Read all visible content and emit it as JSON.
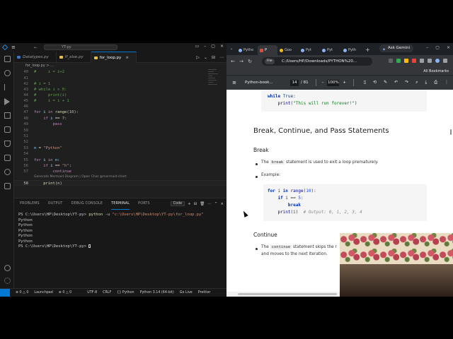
{
  "vscode": {
    "search_text": "YT-py",
    "tabs": [
      {
        "label": "Datatypes.py",
        "active": false
      },
      {
        "label": "If_else.py",
        "active": false
      },
      {
        "label": "for_loop.py",
        "active": true
      }
    ],
    "tab_close": "×",
    "editor_actions": [
      "▷",
      "⌄",
      "⊟",
      "⋯"
    ],
    "breadcrumb": "for_loop.py > ...",
    "lines": [
      {
        "n": "40",
        "tokens": [
          [
            "cm",
            "#     i = i+2"
          ]
        ]
      },
      {
        "n": "41",
        "tokens": []
      },
      {
        "n": "42",
        "tokens": [
          [
            "cm",
            "# i = 1"
          ]
        ]
      },
      {
        "n": "43",
        "tokens": [
          [
            "cm",
            "# while i > 0:"
          ]
        ]
      },
      {
        "n": "44",
        "tokens": [
          [
            "cm",
            "#     print(i)"
          ]
        ]
      },
      {
        "n": "45",
        "tokens": [
          [
            "cm",
            "#     i = i + 1"
          ]
        ]
      },
      {
        "n": "46",
        "tokens": []
      },
      {
        "n": "47",
        "tokens": [
          [
            "kw",
            "for "
          ],
          [
            "var",
            "i "
          ],
          [
            "kw",
            "in "
          ],
          [
            "fn",
            "range"
          ],
          [
            "op",
            "("
          ],
          [
            "num",
            "10"
          ],
          [
            "op",
            "):"
          ]
        ]
      },
      {
        "n": "48",
        "tokens": [
          [
            "op",
            "    "
          ],
          [
            "kw",
            "if "
          ],
          [
            "var",
            "i "
          ],
          [
            "op",
            "== "
          ],
          [
            "num",
            "7"
          ],
          [
            "op",
            ":"
          ]
        ]
      },
      {
        "n": "49",
        "tokens": [
          [
            "op",
            "        "
          ],
          [
            "kw",
            "pass"
          ]
        ]
      },
      {
        "n": "50",
        "tokens": []
      },
      {
        "n": "51",
        "tokens": []
      },
      {
        "n": "52",
        "tokens": []
      },
      {
        "n": "53",
        "tokens": [
          [
            "var",
            "n "
          ],
          [
            "op",
            "= "
          ],
          [
            "str",
            "\"Python\""
          ]
        ]
      },
      {
        "n": "54",
        "tokens": []
      },
      {
        "n": "55",
        "tokens": [
          [
            "kw",
            "for "
          ],
          [
            "var",
            "i "
          ],
          [
            "kw",
            "in "
          ],
          [
            "var",
            "n"
          ],
          [
            "op",
            ":"
          ]
        ]
      },
      {
        "n": "56",
        "tokens": [
          [
            "op",
            "    "
          ],
          [
            "kw",
            "if "
          ],
          [
            "var",
            "i "
          ],
          [
            "op",
            "== "
          ],
          [
            "str",
            "\"h\""
          ],
          [
            "op",
            ":"
          ]
        ]
      },
      {
        "n": "57",
        "tokens": [
          [
            "op",
            "        "
          ],
          [
            "kw",
            "continue"
          ]
        ]
      },
      {
        "n": "",
        "codelens": "Generate Mermaid Diagram | Open Chat @mermaid-chart"
      },
      {
        "n": "58",
        "current": true,
        "tokens": [
          [
            "op",
            "    "
          ],
          [
            "fn",
            "print"
          ],
          [
            "op",
            "("
          ],
          [
            "var",
            "n"
          ],
          [
            "op",
            ")"
          ]
        ]
      }
    ],
    "panel_tabs": [
      "PROBLEMS",
      "OUTPUT",
      "DEBUG CONSOLE",
      "TERMINAL",
      "PORTS"
    ],
    "panel_active": "TERMINAL",
    "panel_select": "Code",
    "panel_icons": [
      "+",
      "⊟",
      "🗑",
      "⋯",
      "⌃",
      "×"
    ],
    "terminal": {
      "prompt": "PS C:\\Users\\HP\\Desktop\\YT-py>",
      "command": "python",
      "flag": "-u",
      "arg": "\"c:\\Users\\HP\\Desktop\\YT-py\\for_loop.py\"",
      "output": [
        "Python",
        "Python",
        "Python",
        "Python",
        "Python"
      ],
      "last_prompt": "PS C:\\Users\\HP\\Desktop\\YT-py>"
    },
    "status": [
      "⊗ 0  △ 0",
      "Launchpad",
      "⊗ 0  △ 0",
      "UTF-8",
      "CRLF",
      "{} Python",
      "Python 3.14 (64-bit)",
      "Go Live",
      "Prettier"
    ]
  },
  "chrome": {
    "tabs": [
      {
        "label": "Pytho",
        "icon": "globe"
      },
      {
        "label": "P",
        "icon": "pdf",
        "active": true
      },
      {
        "label": "Goo",
        "icon": "g"
      },
      {
        "label": "Pyt",
        "icon": "globe"
      },
      {
        "label": "Pyt",
        "icon": "globe"
      },
      {
        "label": "Pyth",
        "icon": "globe"
      }
    ],
    "ask_gemini": "Ask Gemini",
    "file_chip": "File",
    "url": "C:/Users/HP/Downloads/PYTHON%20...",
    "all_bookmarks": "All Bookmarks",
    "pdf": {
      "title": "Python-book...",
      "page": "14",
      "total": "/ 81",
      "zoom": "100%",
      "code1": {
        "lines": [
          [
            [
              "kw",
              "while "
            ],
            [
              "const",
              "True"
            ],
            [
              "op",
              ":"
            ]
          ],
          [
            [
              "op",
              "    "
            ],
            [
              "fn",
              "print"
            ],
            [
              "op",
              "("
            ],
            [
              "str",
              "\"This will run forever!\""
            ],
            [
              "op",
              ")"
            ]
          ]
        ]
      },
      "heading": "Break, Continue, and Pass Statements",
      "break_heading": "Break",
      "break_text_pre": "The",
      "break_code": "break",
      "break_text_post": "statement is used to exit a loop prematurely.",
      "example_label": "Example:",
      "code2": {
        "lines": [
          [
            [
              "kw",
              "for "
            ],
            [
              "op",
              "i "
            ],
            [
              "kw",
              "in "
            ],
            [
              "fn",
              "range"
            ],
            [
              "op",
              "("
            ],
            [
              "num",
              "10"
            ],
            [
              "op",
              "):"
            ]
          ],
          [
            [
              "op",
              "    "
            ],
            [
              "kw",
              "if "
            ],
            [
              "op",
              "i == "
            ],
            [
              "num",
              "5"
            ],
            [
              "op",
              ":"
            ]
          ],
          [
            [
              "op",
              "        "
            ],
            [
              "kw",
              "break"
            ]
          ],
          [
            [
              "op",
              "    "
            ],
            [
              "fn",
              "print"
            ],
            [
              "op",
              "(i)  "
            ],
            [
              "cm",
              "# Output: 0, 1, 2, 3, 4"
            ]
          ]
        ]
      },
      "continue_heading": "Continue",
      "continue_text_pre": "The",
      "continue_code": "continue",
      "continue_text_post": "statement skips the r",
      "continue_text_line2": "and moves to the next iteration."
    }
  }
}
